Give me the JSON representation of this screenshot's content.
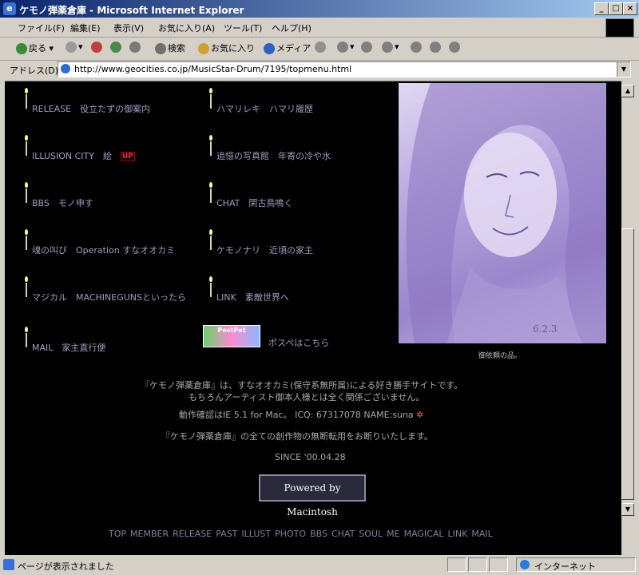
{
  "window": {
    "title": "ケモノ弾薬倉庫 - Microsoft Internet Explorer",
    "controls": {
      "min": "_",
      "max": "□",
      "close": "×"
    }
  },
  "menubar": [
    "ファイル(F)",
    "編集(E)",
    "表示(V)",
    "お気に入り(A)",
    "ツール(T)",
    "ヘルプ(H)"
  ],
  "toolbar": {
    "back": "戻る",
    "search": "検索",
    "favorites": "お気に入り",
    "media": "メディア"
  },
  "address": {
    "label": "アドレス(D)",
    "url": "http://www.geocities.co.jp/MusicStar-Drum/7195/topmenu.html"
  },
  "menu_left": [
    {
      "en": "RELEASE",
      "jp": "役立たずの御案内"
    },
    {
      "en": "ILLUSION CITY",
      "jp": "絵",
      "badge": "UP"
    },
    {
      "en": "BBS",
      "jp": "モノ申す"
    },
    {
      "en": "魂の叫び",
      "jp": "Operation すなオオカミ"
    },
    {
      "en": "マジカル",
      "jp": "MACHINEGUNSといったら"
    },
    {
      "en": "MAIL",
      "jp": "家主直行便"
    }
  ],
  "menu_right": [
    {
      "en": "ハマリレキ",
      "jp": "ハマリ履歴"
    },
    {
      "en": "追憶の写真館",
      "jp": "年寄の冷や水"
    },
    {
      "en": "CHAT",
      "jp": "閑古鳥鳴く"
    },
    {
      "en": "ケモノナリ",
      "jp": "近頃の家主"
    },
    {
      "en": "LINK",
      "jp": "素敵世界へ"
    },
    {
      "en": "",
      "jp": "ポスペはこちら"
    }
  ],
  "postpet_badge": "PostPet",
  "portrait_signature": "6.2.3",
  "portrait_caption": "御依頼の品。",
  "info": {
    "line1": "『ケモノ弾薬倉庫』は、すなオオカミ(保守系無所属)による好き勝手サイトです。",
    "line2": "もちろんアーティスト御本人様とは全く関係ございません。",
    "line3": "動作確認はIE 5.1 for Mac。 ICQ: 67317078 NAME:suna",
    "line4": "『ケモノ弾薬倉庫』の全ての創作物の無断転用をお断りいたします。",
    "line5": "SINCE '00.04.28"
  },
  "powered_label": "Powered by Macintosh",
  "footer_nav": [
    "TOP",
    "MEMBER",
    "RELEASE",
    "PAST",
    "ILLUST",
    "PHOTO",
    "BBS",
    "CHAT",
    "SOUL",
    "ME",
    "MAGICAL",
    "LINK",
    "MAIL"
  ],
  "status": {
    "text": "ページが表示されました",
    "zone": "インターネット"
  }
}
